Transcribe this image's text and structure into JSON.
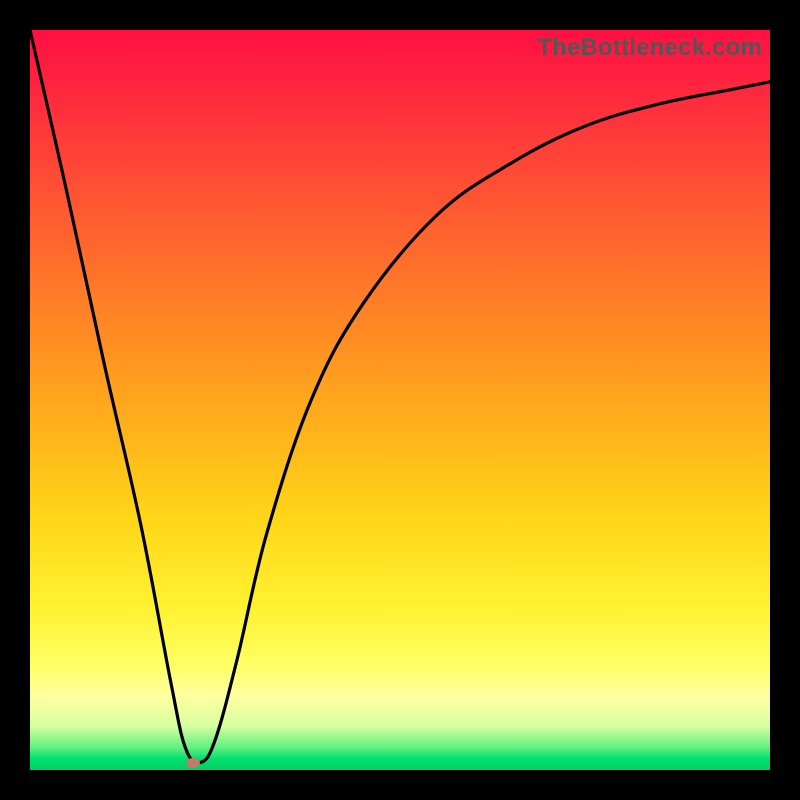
{
  "watermark": "TheBottleneck.com",
  "chart_data": {
    "type": "line",
    "title": "",
    "xlabel": "",
    "ylabel": "",
    "xlim": [
      0,
      100
    ],
    "ylim": [
      0,
      100
    ],
    "grid": false,
    "legend": false,
    "series": [
      {
        "name": "curve",
        "x": [
          0,
          5,
          10,
          15,
          19,
          21,
          23,
          25,
          28,
          32,
          38,
          45,
          55,
          65,
          75,
          85,
          95,
          100
        ],
        "y": [
          100,
          78,
          55,
          33,
          12,
          3,
          1,
          4,
          15,
          32,
          50,
          63,
          75,
          82,
          87,
          90,
          92,
          93
        ]
      }
    ],
    "marker": {
      "x": 22,
      "y": 1,
      "color": "#c47a6a"
    },
    "gradient_stops": [
      {
        "pos": 0.0,
        "color": "#ff1042"
      },
      {
        "pos": 0.3,
        "color": "#ff6a2c"
      },
      {
        "pos": 0.66,
        "color": "#ffd618"
      },
      {
        "pos": 0.86,
        "color": "#ffff66"
      },
      {
        "pos": 1.0,
        "color": "#00d060"
      }
    ]
  }
}
